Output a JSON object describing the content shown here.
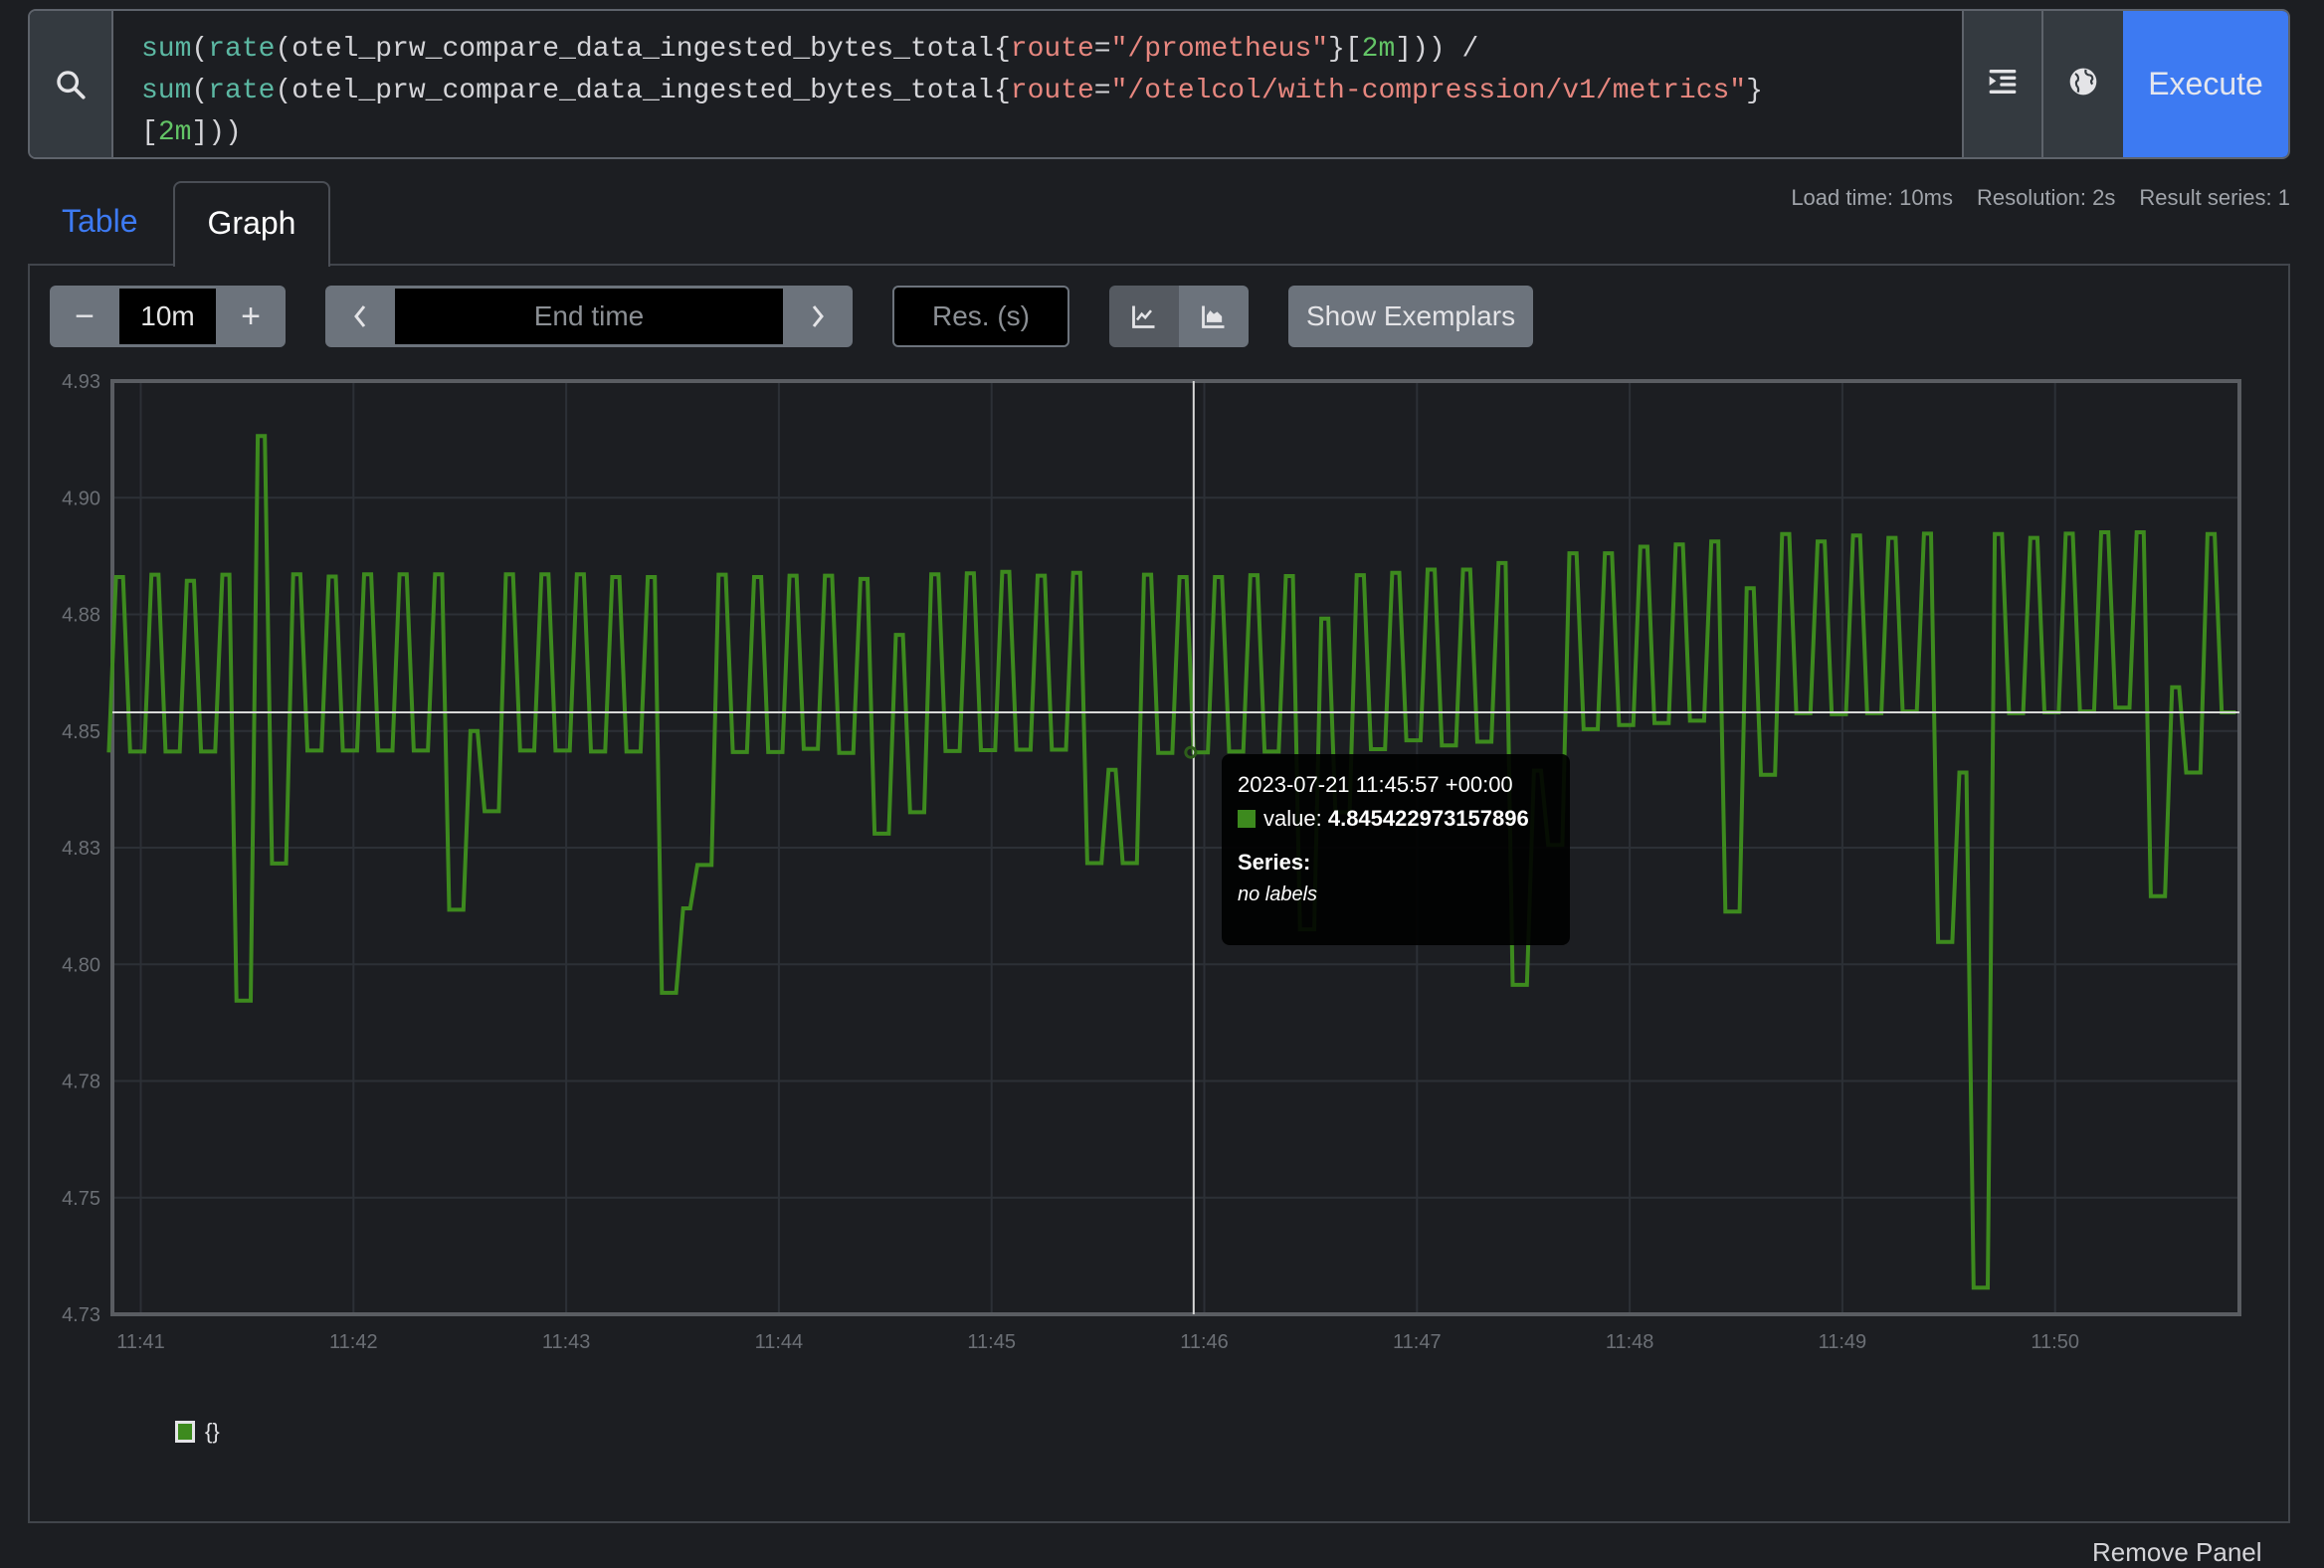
{
  "query": {
    "tokens": [
      {
        "t": "sum",
        "k": "fn"
      },
      {
        "t": "(",
        "k": ""
      },
      {
        "t": "rate",
        "k": "fn"
      },
      {
        "t": "(otel_prw_compare_data_ingested_bytes_total{",
        "k": ""
      },
      {
        "t": "route",
        "k": "lbl"
      },
      {
        "t": "=",
        "k": ""
      },
      {
        "t": "\"/prometheus\"",
        "k": "lbl"
      },
      {
        "t": "}[",
        "k": ""
      },
      {
        "t": "2m",
        "k": "dur"
      },
      {
        "t": "])) /\n",
        "k": ""
      },
      {
        "t": "sum",
        "k": "fn"
      },
      {
        "t": "(",
        "k": ""
      },
      {
        "t": "rate",
        "k": "fn"
      },
      {
        "t": "(otel_prw_compare_data_ingested_bytes_total{",
        "k": ""
      },
      {
        "t": "route",
        "k": "lbl"
      },
      {
        "t": "=",
        "k": ""
      },
      {
        "t": "\"/otelcol/with-compression/v1/metrics\"",
        "k": "lbl"
      },
      {
        "t": "}\n[",
        "k": ""
      },
      {
        "t": "2m",
        "k": "dur"
      },
      {
        "t": "]))",
        "k": ""
      }
    ],
    "search_icon": "search-icon",
    "format_icon": "format-indent-icon",
    "explain_icon": "globe-icon",
    "execute_label": "Execute"
  },
  "tabs": {
    "table": "Table",
    "graph": "Graph",
    "active": "graph"
  },
  "stats": {
    "load_time": "Load time: 10ms",
    "resolution": "Resolution: 2s",
    "result_series": "Result series: 1"
  },
  "controls": {
    "range_minus": "−",
    "range_value": "10m",
    "range_plus": "+",
    "end_time_prev": "‹",
    "end_time_placeholder": "End time",
    "end_time_next": "›",
    "resolution_placeholder": "Res. (s)",
    "chart_type_line": "line-chart-icon",
    "chart_type_stacked": "area-chart-icon",
    "chart_type_active": "line",
    "show_exemplars": "Show Exemplars"
  },
  "tooltip": {
    "time": "2023-07-21 11:45:57 +00:00",
    "value_label": "value:",
    "value": "4.845422973157896",
    "series_label": "Series:",
    "series_value": "no labels"
  },
  "legend": [
    {
      "label": "{}",
      "color": "#3d8a1e"
    }
  ],
  "remove_panel": "Remove Panel",
  "colors": {
    "accent": "#3d7af2",
    "series": "#3d8a1e",
    "plot_bg": "#1c1e22"
  },
  "chart_data": {
    "type": "line",
    "title": "",
    "xlabel": "",
    "ylabel": "",
    "x_ticks": [
      "11:41",
      "11:42",
      "11:43",
      "11:44",
      "11:45",
      "11:46",
      "11:47",
      "11:48",
      "11:49",
      "11:50"
    ],
    "y_ticks": [
      "4.93",
      "4.90",
      "4.88",
      "4.85",
      "4.83",
      "4.80",
      "4.78",
      "4.75",
      "4.73"
    ],
    "y_tick_values": [
      4.925,
      4.9,
      4.875,
      4.85,
      4.825,
      4.8,
      4.775,
      4.75,
      4.725
    ],
    "ylim": [
      4.725,
      4.925
    ],
    "xlim_seconds_from_1140": [
      52,
      652
    ],
    "grid": true,
    "legend": "bottom-left",
    "series": [
      {
        "name": "{}",
        "start_time": "11:40:51",
        "start_seconds_from_1140": 51,
        "step_seconds": 2,
        "runs": [
          [
            4.8454,
            1
          ],
          [
            4.883,
            2
          ],
          [
            4.8456,
            3
          ],
          [
            4.8835,
            2
          ],
          [
            4.8456,
            3
          ],
          [
            4.8822,
            2
          ],
          [
            4.8456,
            3
          ],
          [
            4.8835,
            2
          ],
          [
            4.7922,
            3
          ],
          [
            4.9132,
            2
          ],
          [
            4.8216,
            3
          ],
          [
            4.8836,
            2
          ],
          [
            4.8458,
            3
          ],
          [
            4.8831,
            2
          ],
          [
            4.8458,
            3
          ],
          [
            4.8836,
            2
          ],
          [
            4.8458,
            3
          ],
          [
            4.8836,
            2
          ],
          [
            4.8458,
            3
          ],
          [
            4.8836,
            2
          ],
          [
            4.8117,
            3
          ],
          [
            4.85,
            2
          ],
          [
            4.8328,
            3
          ],
          [
            4.8836,
            2
          ],
          [
            4.8458,
            3
          ],
          [
            4.8836,
            2
          ],
          [
            4.8458,
            3
          ],
          [
            4.8836,
            2
          ],
          [
            4.8456,
            3
          ],
          [
            4.883,
            2
          ],
          [
            4.8456,
            3
          ],
          [
            4.883,
            2
          ],
          [
            4.7939,
            3
          ],
          [
            4.812,
            2
          ],
          [
            4.8213,
            3
          ],
          [
            4.8835,
            2
          ],
          [
            4.8455,
            3
          ],
          [
            4.883,
            2
          ],
          [
            4.8455,
            3
          ],
          [
            4.8833,
            2
          ],
          [
            4.8462,
            3
          ],
          [
            4.8833,
            2
          ],
          [
            4.8453,
            3
          ],
          [
            4.8826,
            2
          ],
          [
            4.828,
            3
          ],
          [
            4.8706,
            2
          ],
          [
            4.8326,
            3
          ],
          [
            4.8836,
            2
          ],
          [
            4.8457,
            3
          ],
          [
            4.8838,
            2
          ],
          [
            4.8459,
            3
          ],
          [
            4.8841,
            2
          ],
          [
            4.846,
            3
          ],
          [
            4.8833,
            2
          ],
          [
            4.846,
            3
          ],
          [
            4.8839,
            2
          ],
          [
            4.8217,
            3
          ],
          [
            4.8417,
            2
          ],
          [
            4.8217,
            3
          ],
          [
            4.8835,
            2
          ],
          [
            4.8453,
            3
          ],
          [
            4.883,
            2
          ],
          [
            4.845422973157896,
            3
          ],
          [
            4.883,
            2
          ],
          [
            4.8456,
            3
          ],
          [
            4.8834,
            2
          ],
          [
            4.8456,
            3
          ],
          [
            4.8832,
            2
          ],
          [
            4.8075,
            3
          ],
          [
            4.8741,
            2
          ],
          [
            4.8326,
            3
          ],
          [
            4.8834,
            2
          ],
          [
            4.8461,
            3
          ],
          [
            4.8839,
            2
          ],
          [
            4.848,
            3
          ],
          [
            4.8846,
            2
          ],
          [
            4.8469,
            3
          ],
          [
            4.8846,
            2
          ],
          [
            4.8477,
            3
          ],
          [
            4.886,
            2
          ],
          [
            4.7956,
            3
          ],
          [
            4.8415,
            2
          ],
          [
            4.8256,
            3
          ],
          [
            4.8881,
            2
          ],
          [
            4.8504,
            3
          ],
          [
            4.8881,
            2
          ],
          [
            4.8513,
            3
          ],
          [
            4.8895,
            2
          ],
          [
            4.8517,
            3
          ],
          [
            4.89,
            2
          ],
          [
            4.8522,
            3
          ],
          [
            4.8906,
            2
          ],
          [
            4.8113,
            3
          ],
          [
            4.8806,
            2
          ],
          [
            4.8406,
            3
          ],
          [
            4.8922,
            2
          ],
          [
            4.8538,
            3
          ],
          [
            4.8906,
            2
          ],
          [
            4.8536,
            3
          ],
          [
            4.8919,
            2
          ],
          [
            4.8538,
            3
          ],
          [
            4.8914,
            2
          ],
          [
            4.8542,
            3
          ],
          [
            4.8923,
            2
          ],
          [
            4.8048,
            3
          ],
          [
            4.8411,
            2
          ],
          [
            4.7307,
            3
          ],
          [
            4.8922,
            2
          ],
          [
            4.8538,
            3
          ],
          [
            4.8914,
            2
          ],
          [
            4.854,
            3
          ],
          [
            4.8923,
            2
          ],
          [
            4.8542,
            3
          ],
          [
            4.8926,
            2
          ],
          [
            4.855,
            3
          ],
          [
            4.8926,
            2
          ],
          [
            4.8146,
            3
          ],
          [
            4.8594,
            2
          ],
          [
            4.8411,
            3
          ],
          [
            4.8922,
            2
          ],
          [
            4.854,
            3
          ]
        ]
      }
    ],
    "hover": {
      "time_seconds_from_1140": 357,
      "value": 4.845422973157896,
      "crosshair_value": 4.854
    }
  }
}
